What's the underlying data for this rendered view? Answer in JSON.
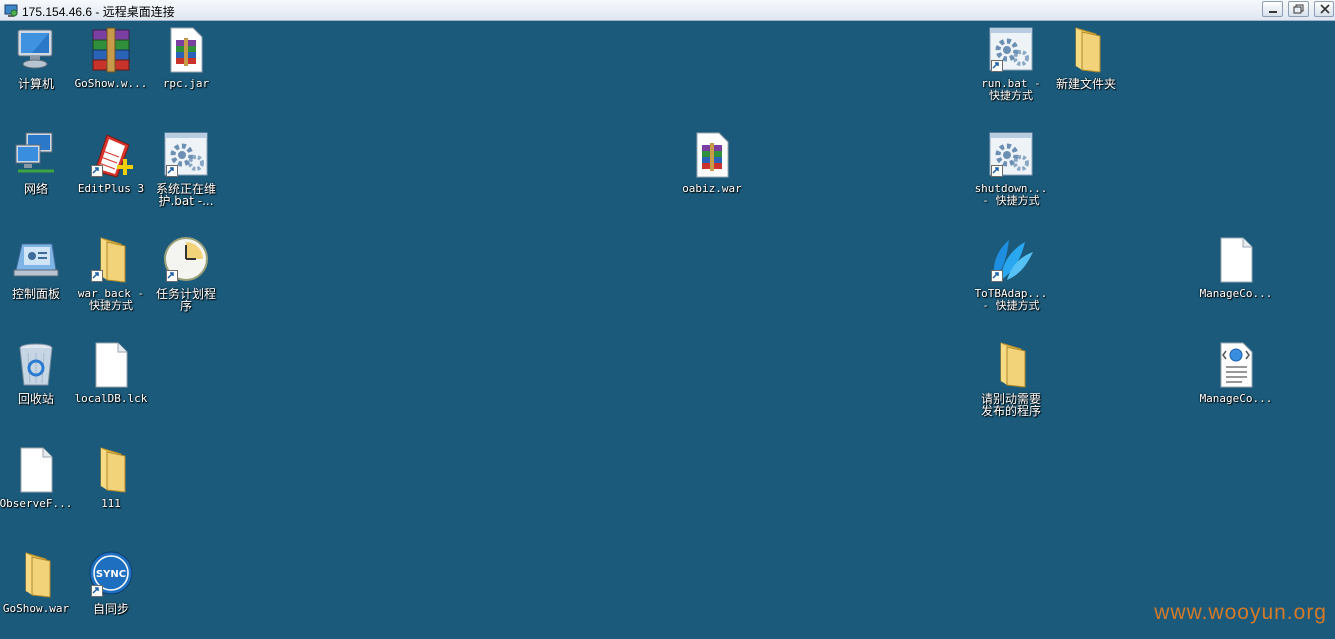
{
  "window": {
    "title": "175.154.46.6 - 远程桌面连接"
  },
  "desktop_icons": [
    {
      "label": "计算机",
      "icon": "computer-icon"
    },
    {
      "label": "GoShow.w...",
      "icon": "winrar-archive-icon"
    },
    {
      "label": "rpc.jar",
      "icon": "jar-archive-icon"
    },
    {
      "label": "网络",
      "icon": "network-icon"
    },
    {
      "label": "EditPlus 3",
      "icon": "editplus-icon"
    },
    {
      "label": "系统正在维\n护.bat -...",
      "icon": "batch-file-icon"
    },
    {
      "label": "控制面板",
      "icon": "control-panel-icon"
    },
    {
      "label": "war_back -\n快捷方式",
      "icon": "folder-icon"
    },
    {
      "label": "任务计划程\n序",
      "icon": "task-scheduler-icon"
    },
    {
      "label": "回收站",
      "icon": "recycle-bin-icon"
    },
    {
      "label": "localDB.lck",
      "icon": "file-icon"
    },
    {
      "label": "ObserveF...",
      "icon": "file-icon"
    },
    {
      "label": "111",
      "icon": "folder-icon"
    },
    {
      "label": "GoShow.war",
      "icon": "folder-icon"
    },
    {
      "label": "自同步",
      "icon": "sync-icon"
    },
    {
      "label": "oabiz.war",
      "icon": "winrar-archive-icon"
    },
    {
      "label": "run.bat -\n快捷方式",
      "icon": "batch-file-icon"
    },
    {
      "label": "新建文件夹",
      "icon": "folder-icon"
    },
    {
      "label": "shutdown...\n- 快捷方式",
      "icon": "batch-file-icon"
    },
    {
      "label": "ToTBAdap...\n- 快捷方式",
      "icon": "app-icon"
    },
    {
      "label": "ManageCo...",
      "icon": "file-icon"
    },
    {
      "label": "请别动需要\n发布的程序",
      "icon": "folder-icon"
    },
    {
      "label": "ManageCo...",
      "icon": "web-config-icon"
    }
  ],
  "watermark": "www.wooyun.org",
  "colors": {
    "desktop": "#1b5a7a",
    "watermark": "#d27a2a"
  }
}
